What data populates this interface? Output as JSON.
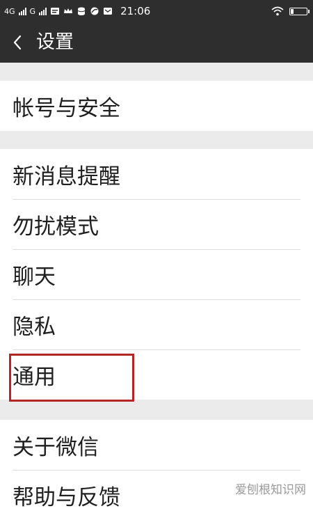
{
  "status_bar": {
    "network_1": "4G",
    "network_2": "G",
    "time": "21:06"
  },
  "header": {
    "title": "设置"
  },
  "groups": [
    {
      "items": [
        {
          "label": "帐号与安全"
        }
      ]
    },
    {
      "items": [
        {
          "label": "新消息提醒"
        },
        {
          "label": "勿扰模式"
        },
        {
          "label": "聊天"
        },
        {
          "label": "隐私"
        },
        {
          "label": "通用"
        }
      ]
    },
    {
      "items": [
        {
          "label": "关于微信"
        },
        {
          "label": "帮助与反馈"
        }
      ]
    }
  ],
  "highlighted_item": "通用",
  "watermark": "爱刨根知识网",
  "colors": {
    "header_bg": "#2e2e2e",
    "page_bg": "#ebebeb",
    "row_bg": "#ffffff",
    "highlight": "#b42626"
  }
}
